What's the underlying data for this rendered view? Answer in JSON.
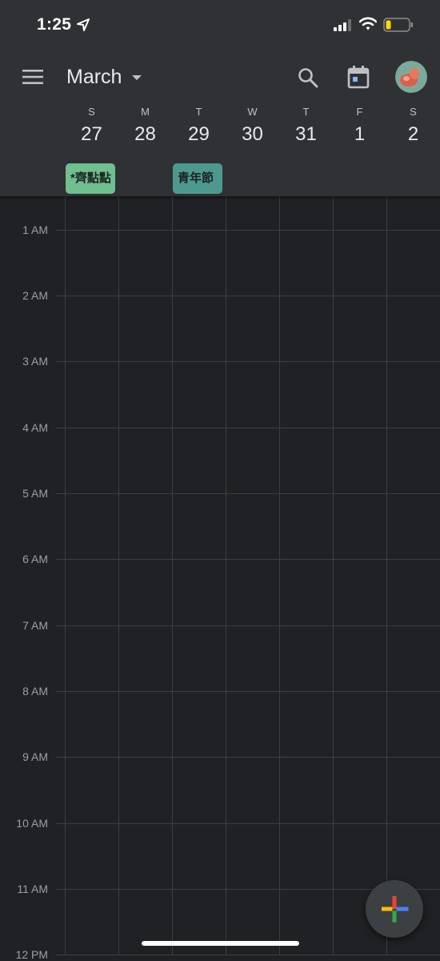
{
  "status_bar": {
    "time": "1:25"
  },
  "header": {
    "month": "March",
    "days": [
      {
        "letter": "S",
        "num": "27"
      },
      {
        "letter": "M",
        "num": "28"
      },
      {
        "letter": "T",
        "num": "29"
      },
      {
        "letter": "W",
        "num": "30"
      },
      {
        "letter": "T",
        "num": "31"
      },
      {
        "letter": "F",
        "num": "1"
      },
      {
        "letter": "S",
        "num": "2"
      }
    ]
  },
  "all_day_events": [
    {
      "title": "*齊點點",
      "color": "#6fbf8f"
    },
    {
      "title": "青年節",
      "color": "#4c9a8e"
    }
  ],
  "hours": [
    "1 AM",
    "2 AM",
    "3 AM",
    "4 AM",
    "5 AM",
    "6 AM",
    "7 AM",
    "8 AM",
    "9 AM",
    "10 AM",
    "11 AM",
    "12 PM"
  ],
  "icons": {
    "menu": "hamburger-menu-icon",
    "caret": "caret-down-icon",
    "search": "search-icon",
    "today": "calendar-today-icon",
    "fab": "plus-icon"
  },
  "colors": {
    "background": "#202124",
    "header": "#303134",
    "fab_plus": [
      "#4285f4",
      "#ea4335",
      "#fbbc04",
      "#34a853"
    ]
  }
}
